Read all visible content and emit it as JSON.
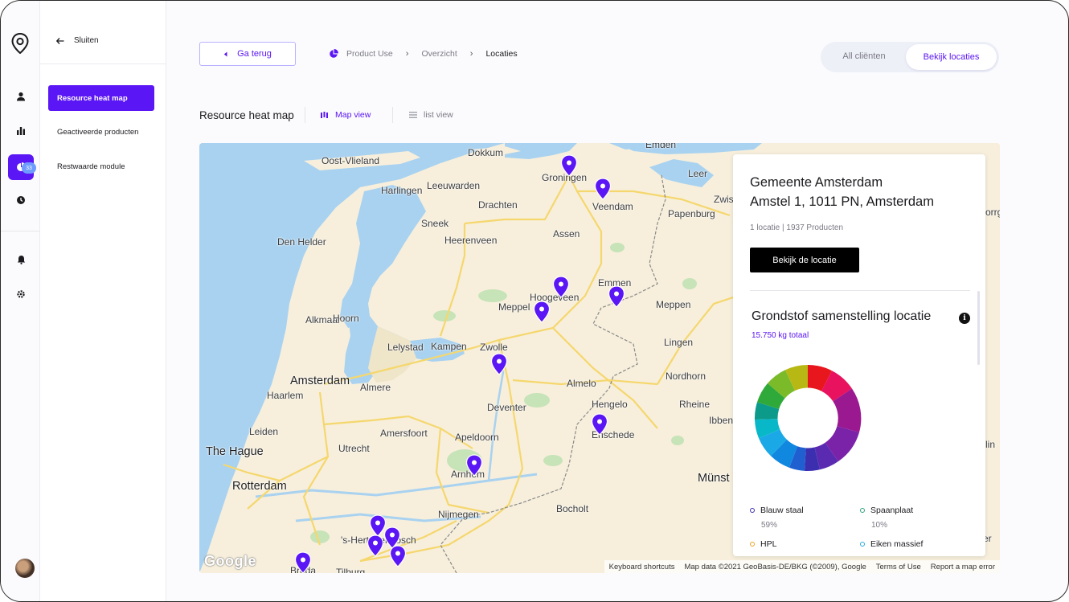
{
  "subnav": {
    "close_label": "Sluiten",
    "items": [
      {
        "label": "Resource heat map",
        "active": true
      },
      {
        "label": "Geactiveerde producten",
        "active": false
      },
      {
        "label": "Restwaarde module",
        "active": false
      }
    ]
  },
  "rail": {
    "badge": "33",
    "icons": [
      "user-icon",
      "bar-chart-icon",
      "pie-chart-icon",
      "clock-icon",
      "bell-icon",
      "settings-icon"
    ]
  },
  "topbar": {
    "back_label": "Ga terug",
    "breadcrumb": [
      "Product Use",
      "Overzicht",
      "Locaties"
    ],
    "toggle": {
      "option_a": "All cliënten",
      "option_b": "Bekijk locaties",
      "selected": "Bekijk locaties"
    }
  },
  "view": {
    "title": "Resource heat map",
    "tabs": [
      {
        "label": "Map view",
        "active": true
      },
      {
        "label": "list view",
        "active": false
      }
    ]
  },
  "map": {
    "cities": [
      "Dokkum",
      "Oost-Vlieland",
      "Harlingen",
      "Leeuwarden",
      "Groningen",
      "Veendam",
      "Leer",
      "Emden",
      "Papenburg",
      "Drachten",
      "Sneek",
      "Heerenveen",
      "Assen",
      "Den Helder",
      "Emmen",
      "Hoogeveen",
      "Meppel",
      "Meppen",
      "Alkmaar",
      "Hoorn",
      "Lingen",
      "Lelystad",
      "Kampen",
      "Zwolle",
      "Amsterdam",
      "Almere",
      "Haarlem",
      "Almelo",
      "Nordhorn",
      "Deventer",
      "Hengelo",
      "Enschede",
      "Rheine",
      "Leiden",
      "Amersfoort",
      "Utrecht",
      "Apeldoorn",
      "The Hague",
      "Arnhem",
      "Rotterdam",
      "Münst",
      "Nijmegen",
      "Bocholt",
      "'s-Hertogenbosch",
      "Breda",
      "Tilburg",
      "Zwis",
      "Ibben",
      "lin",
      "orrg",
      "er"
    ],
    "attribution": [
      "Keyboard shortcuts",
      "Map data ©2021 GeoBasis-DE/BKG (©2009), Google",
      "Terms of Use",
      "Report a map error"
    ],
    "logo": "Google",
    "pin_color": "#5b16f5"
  },
  "card": {
    "name_line1": "Gemeente Amsterdam",
    "name_line2": "Amstel 1, 1011 PN, Amsterdam",
    "meta": "1 locatie | 1937 Producten",
    "button": "Bekijk de locatie",
    "section_title": "Grondstof samenstelling locatie",
    "info_glyph": "i",
    "total": "15.750 kg totaal",
    "legend": [
      {
        "label": "Blauw staal",
        "pct": "59%",
        "color": "#3b2fb0"
      },
      {
        "label": "Spaanplaat",
        "pct": "10%",
        "color": "#2fa37a"
      },
      {
        "label": "HPL",
        "pct": "",
        "color": "#f0a020"
      },
      {
        "label": "Eiken massief",
        "pct": "",
        "color": "#29a8e0"
      }
    ]
  },
  "colors": {
    "accent": "#5b16f5",
    "badge": "#6d9bff"
  }
}
